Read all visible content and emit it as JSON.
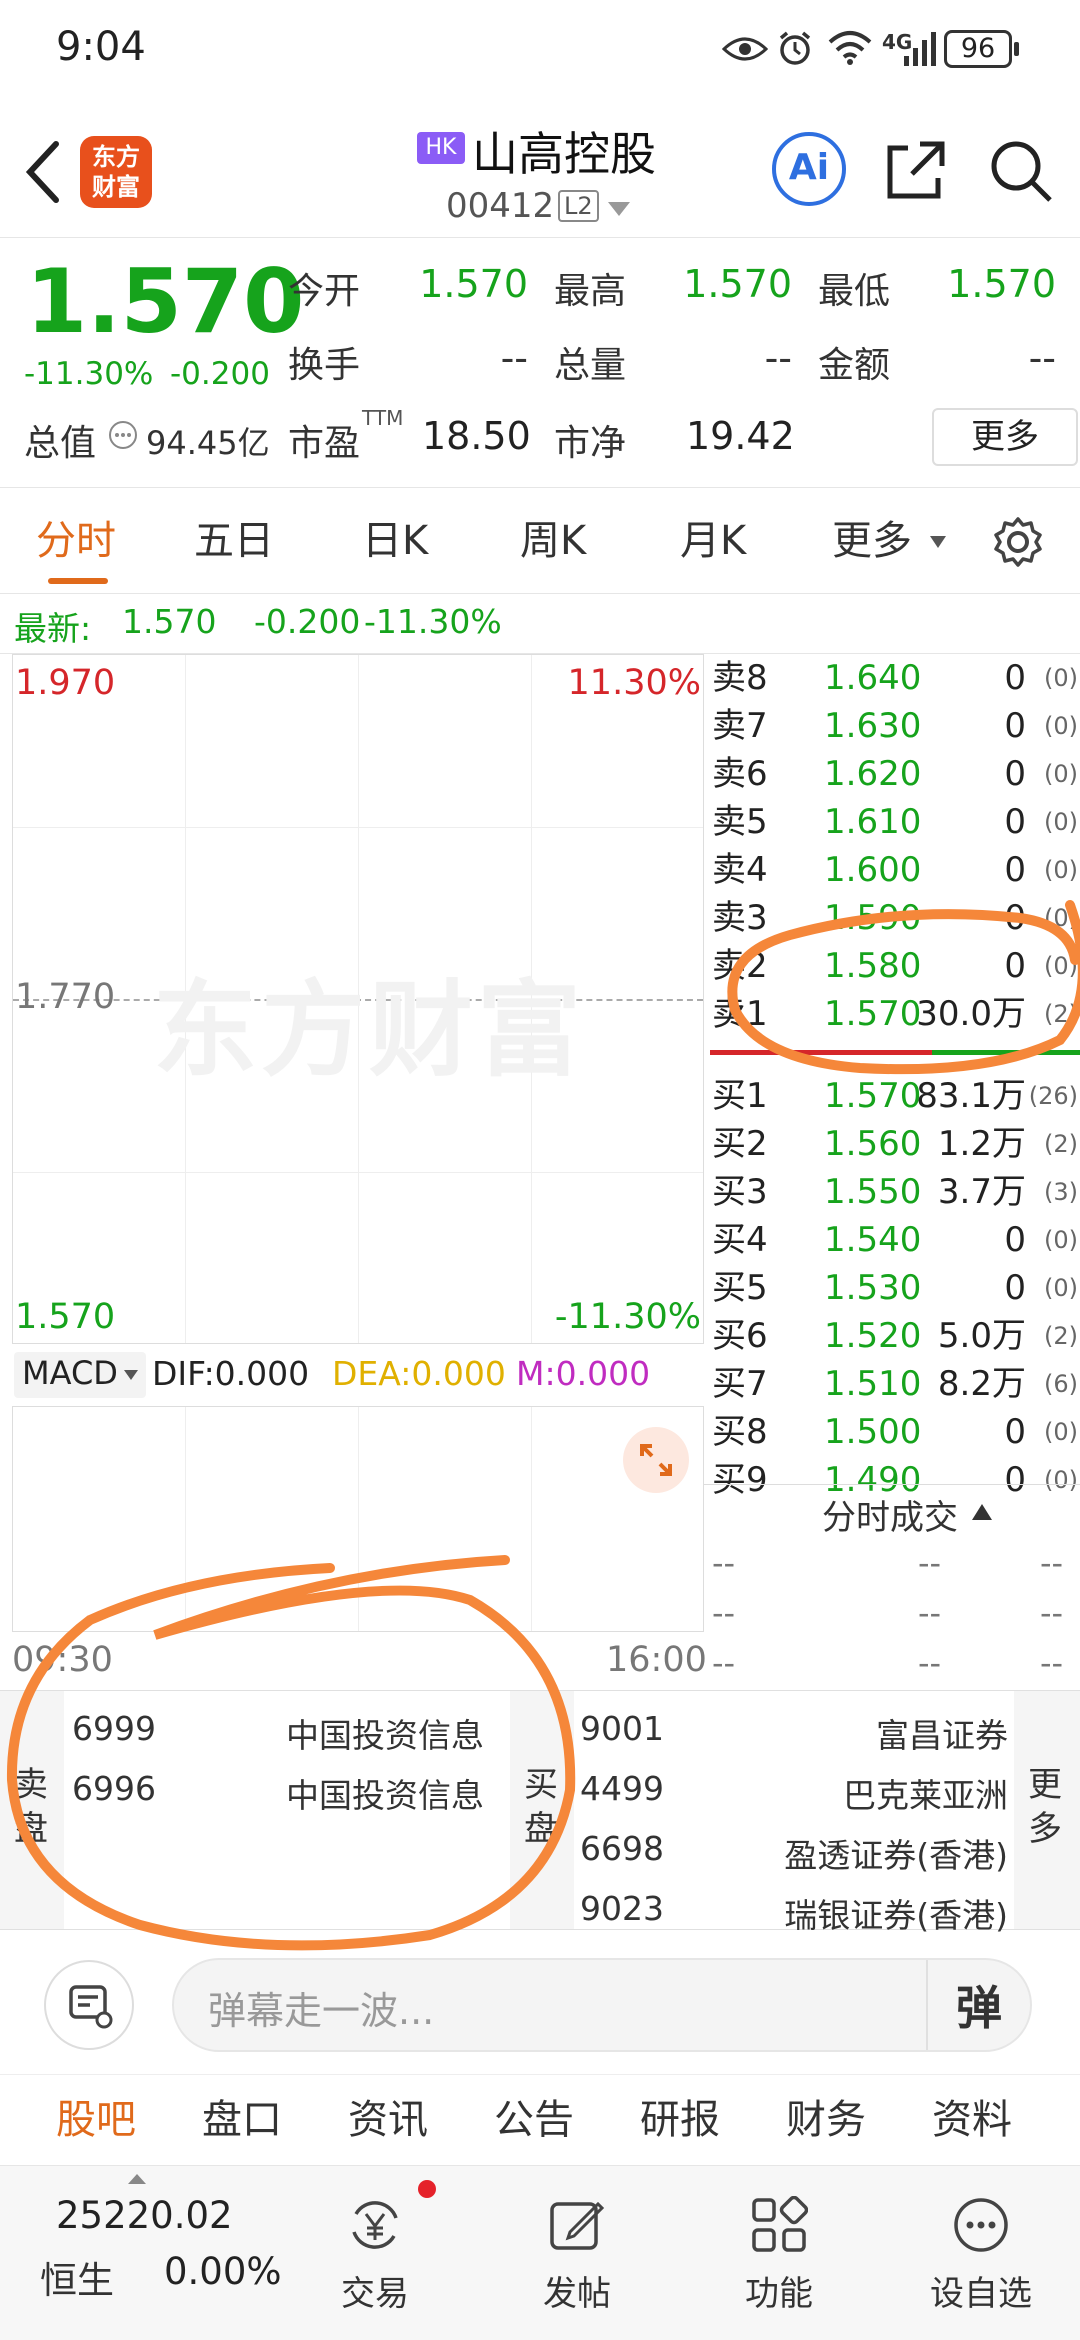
{
  "status": {
    "time": "9:04",
    "battery": "96",
    "network": "4G"
  },
  "header": {
    "market_badge": "HK",
    "stock_name": "山高控股",
    "stock_code": "00412",
    "level_badge": "L2",
    "logo_text_line1": "东方",
    "logo_text_line2": "财富",
    "ai_label": "Ai"
  },
  "quote": {
    "price": "1.570",
    "change_pct": "-11.30%",
    "change": "-0.200",
    "open_label": "今开",
    "open": "1.570",
    "high_label": "最高",
    "high": "1.570",
    "low_label": "最低",
    "low": "1.570",
    "turnover_label": "换手",
    "turnover": "--",
    "volume_label": "总量",
    "volume": "--",
    "amount_label": "金额",
    "amount": "--",
    "mcap_label": "总值",
    "mcap": "94.45亿",
    "pe_label": "市盈",
    "pe_sup": "TTM",
    "pe": "18.50",
    "pb_label": "市净",
    "pb": "19.42",
    "more_button": "更多"
  },
  "tabs": [
    "分时",
    "五日",
    "日K",
    "周K",
    "月K",
    "更多"
  ],
  "latest": {
    "label": "最新:",
    "price": "1.570",
    "change": "-0.200",
    "pct": "-11.30%"
  },
  "chart": {
    "top_price": "1.970",
    "top_pct": "11.30%",
    "mid_price": "1.770",
    "bottom_price": "1.570",
    "bottom_pct": "-11.30%",
    "watermark": "东方财富",
    "time_start": "09:30",
    "time_end": "16:00"
  },
  "macd": {
    "selector": "MACD",
    "dif": "DIF:0.000",
    "dea": "DEA:0.000",
    "m": "M:0.000"
  },
  "orderbook": {
    "asks": [
      {
        "label": "卖8",
        "price": "1.640",
        "vol": "0",
        "count": "(0)"
      },
      {
        "label": "卖7",
        "price": "1.630",
        "vol": "0",
        "count": "(0)"
      },
      {
        "label": "卖6",
        "price": "1.620",
        "vol": "0",
        "count": "(0)"
      },
      {
        "label": "卖5",
        "price": "1.610",
        "vol": "0",
        "count": "(0)"
      },
      {
        "label": "卖4",
        "price": "1.600",
        "vol": "0",
        "count": "(0)"
      },
      {
        "label": "卖3",
        "price": "1.590",
        "vol": "0",
        "count": "(0)"
      },
      {
        "label": "卖2",
        "price": "1.580",
        "vol": "0",
        "count": "(0)"
      },
      {
        "label": "卖1",
        "price": "1.570",
        "vol": "30.0万",
        "count": "(2)"
      }
    ],
    "bids": [
      {
        "label": "买1",
        "price": "1.570",
        "vol": "83.1万",
        "count": "(26)"
      },
      {
        "label": "买2",
        "price": "1.560",
        "vol": "1.2万",
        "count": "(2)"
      },
      {
        "label": "买3",
        "price": "1.550",
        "vol": "3.7万",
        "count": "(3)"
      },
      {
        "label": "买4",
        "price": "1.540",
        "vol": "0",
        "count": "(0)"
      },
      {
        "label": "买5",
        "price": "1.530",
        "vol": "0",
        "count": "(0)"
      },
      {
        "label": "买6",
        "price": "1.520",
        "vol": "5.0万",
        "count": "(2)"
      },
      {
        "label": "买7",
        "price": "1.510",
        "vol": "8.2万",
        "count": "(6)"
      },
      {
        "label": "买8",
        "price": "1.500",
        "vol": "0",
        "count": "(0)"
      },
      {
        "label": "买9",
        "price": "1.490",
        "vol": "0",
        "count": "(0)"
      }
    ]
  },
  "trades": {
    "title": "分时成交",
    "placeholder": "--"
  },
  "brokers": {
    "sell_label_1": "卖",
    "sell_label_2": "盘",
    "buy_label_1": "买",
    "buy_label_2": "盘",
    "more_1": "更",
    "more_2": "多",
    "sell": [
      {
        "code": "6999",
        "name": "中国投资信息"
      },
      {
        "code": "6996",
        "name": "中国投资信息"
      }
    ],
    "buy": [
      {
        "code": "9001",
        "name": "富昌证券"
      },
      {
        "code": "4499",
        "name": "巴克莱亚洲"
      },
      {
        "code": "6698",
        "name": "盈透证券(香港)"
      },
      {
        "code": "9023",
        "name": "瑞银证券(香港)"
      }
    ]
  },
  "comment": {
    "placeholder": "弹幕走一波..."
  },
  "subtabs": [
    "股吧",
    "盘口",
    "资讯",
    "公告",
    "研报",
    "财务",
    "资料"
  ],
  "bottomnav": {
    "index_value": "25220.02",
    "index_name": "恒生",
    "index_pct": "0.00%",
    "items": [
      "交易",
      "发帖",
      "功能",
      "设自选"
    ]
  },
  "colors": {
    "up": "#d5262a",
    "down": "#16a31c",
    "accent": "#e06a1b",
    "annotation": "#f5873a"
  }
}
